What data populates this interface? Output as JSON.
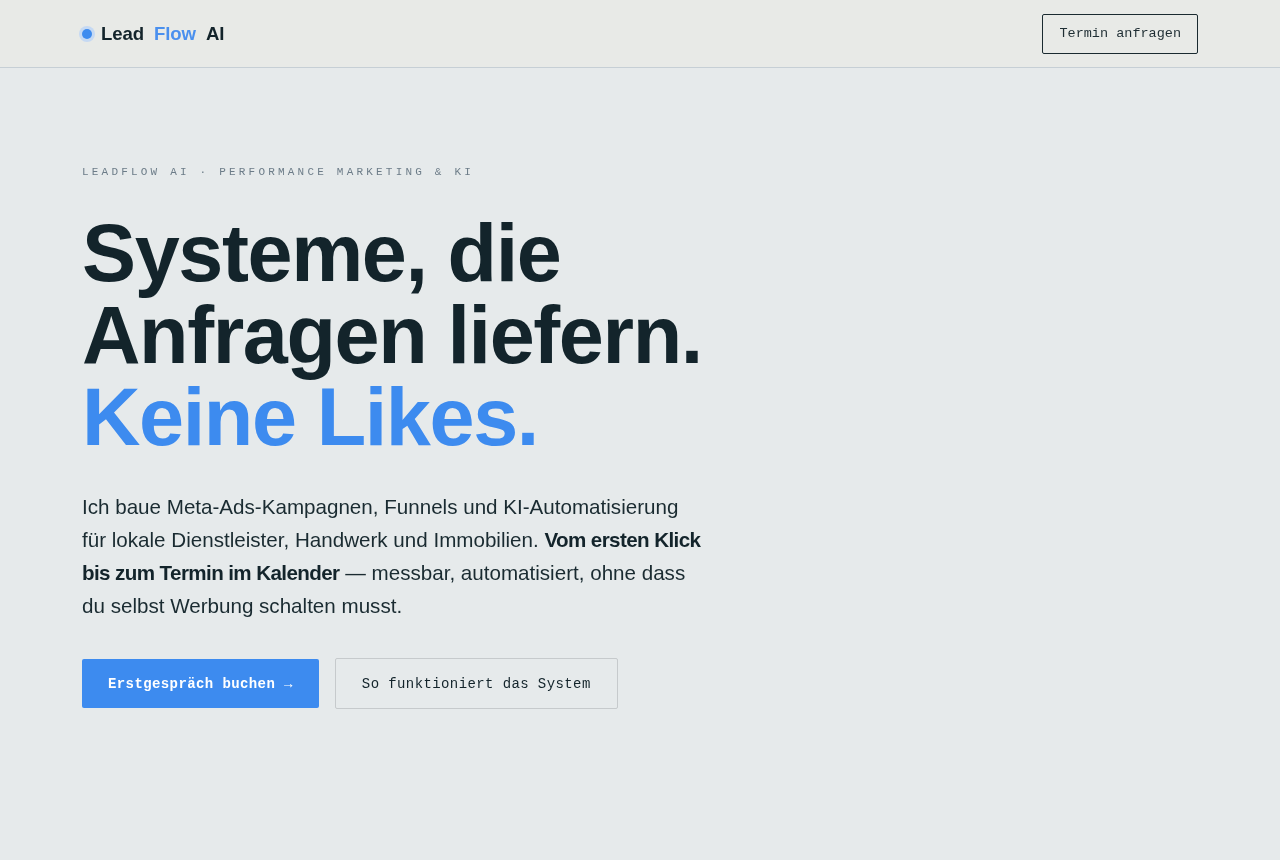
{
  "header": {
    "logo": {
      "lead": "Lead",
      "accent": "Flow",
      "suffix": "AI"
    },
    "nav_button": "Termin anfragen"
  },
  "hero": {
    "eyebrow": "LEADFLOW AI · PERFORMANCE MARKETING & KI",
    "headline": "Systeme, die Anfragen liefern.",
    "headline_accent": "Keine Likes.",
    "intro": "Ich baue Meta-Ads-Kampagnen, Funnels und KI-Automatisierung für lokale Dienstleister, Handwerk und Immobilien. **Vom ersten Klick bis zum Termin im Kalender** — messbar, automatisiert, ohne dass du selbst Werbung schalten musst.",
    "buttons": [
      {
        "label": "Erstgespräch buchen →",
        "kind": "primary"
      },
      {
        "label": "So funktioniert das System",
        "kind": "secondary"
      }
    ]
  }
}
